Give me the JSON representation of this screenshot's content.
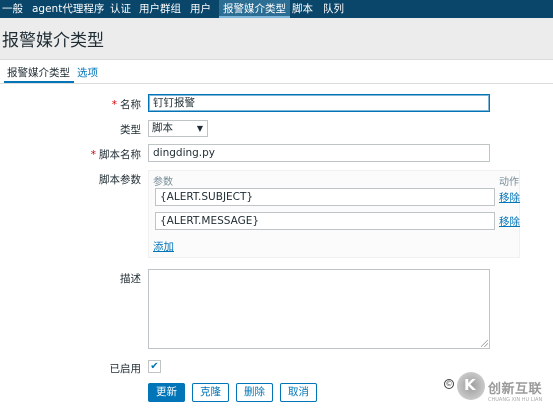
{
  "topnav": {
    "items": [
      "一般",
      "agent代理程序",
      "认证",
      "用户群组",
      "用户",
      "报警媒介类型",
      "脚本",
      "队列"
    ],
    "active_index": 5
  },
  "page": {
    "title": "报警媒介类型"
  },
  "tabs": {
    "media_type": "报警媒介类型",
    "options": "选项"
  },
  "form": {
    "name": {
      "label": "名称",
      "value": "钉钉报警"
    },
    "type": {
      "label": "类型",
      "value": "脚本"
    },
    "script_name": {
      "label": "脚本名称",
      "value": "dingding.py"
    },
    "script_params": {
      "label": "脚本参数",
      "col_param": "参数",
      "col_action": "动作",
      "rows": [
        {
          "value": "{ALERT.SUBJECT}",
          "action": "移除"
        },
        {
          "value": "{ALERT.MESSAGE}",
          "action": "移除"
        }
      ],
      "add": "添加"
    },
    "description": {
      "label": "描述",
      "value": ""
    },
    "enabled": {
      "label": "已启用",
      "checked": true
    }
  },
  "buttons": {
    "update": "更新",
    "clone": "克隆",
    "delete": "删除",
    "cancel": "取消"
  },
  "colors": {
    "nav_bg": "#0a466a",
    "accent": "#0275b8",
    "required": "#d40000"
  },
  "watermark": {
    "symbol": "©",
    "logo_glyph": "K",
    "cn": "创新互联",
    "en": "CHUANG XIN HU LIAN"
  }
}
